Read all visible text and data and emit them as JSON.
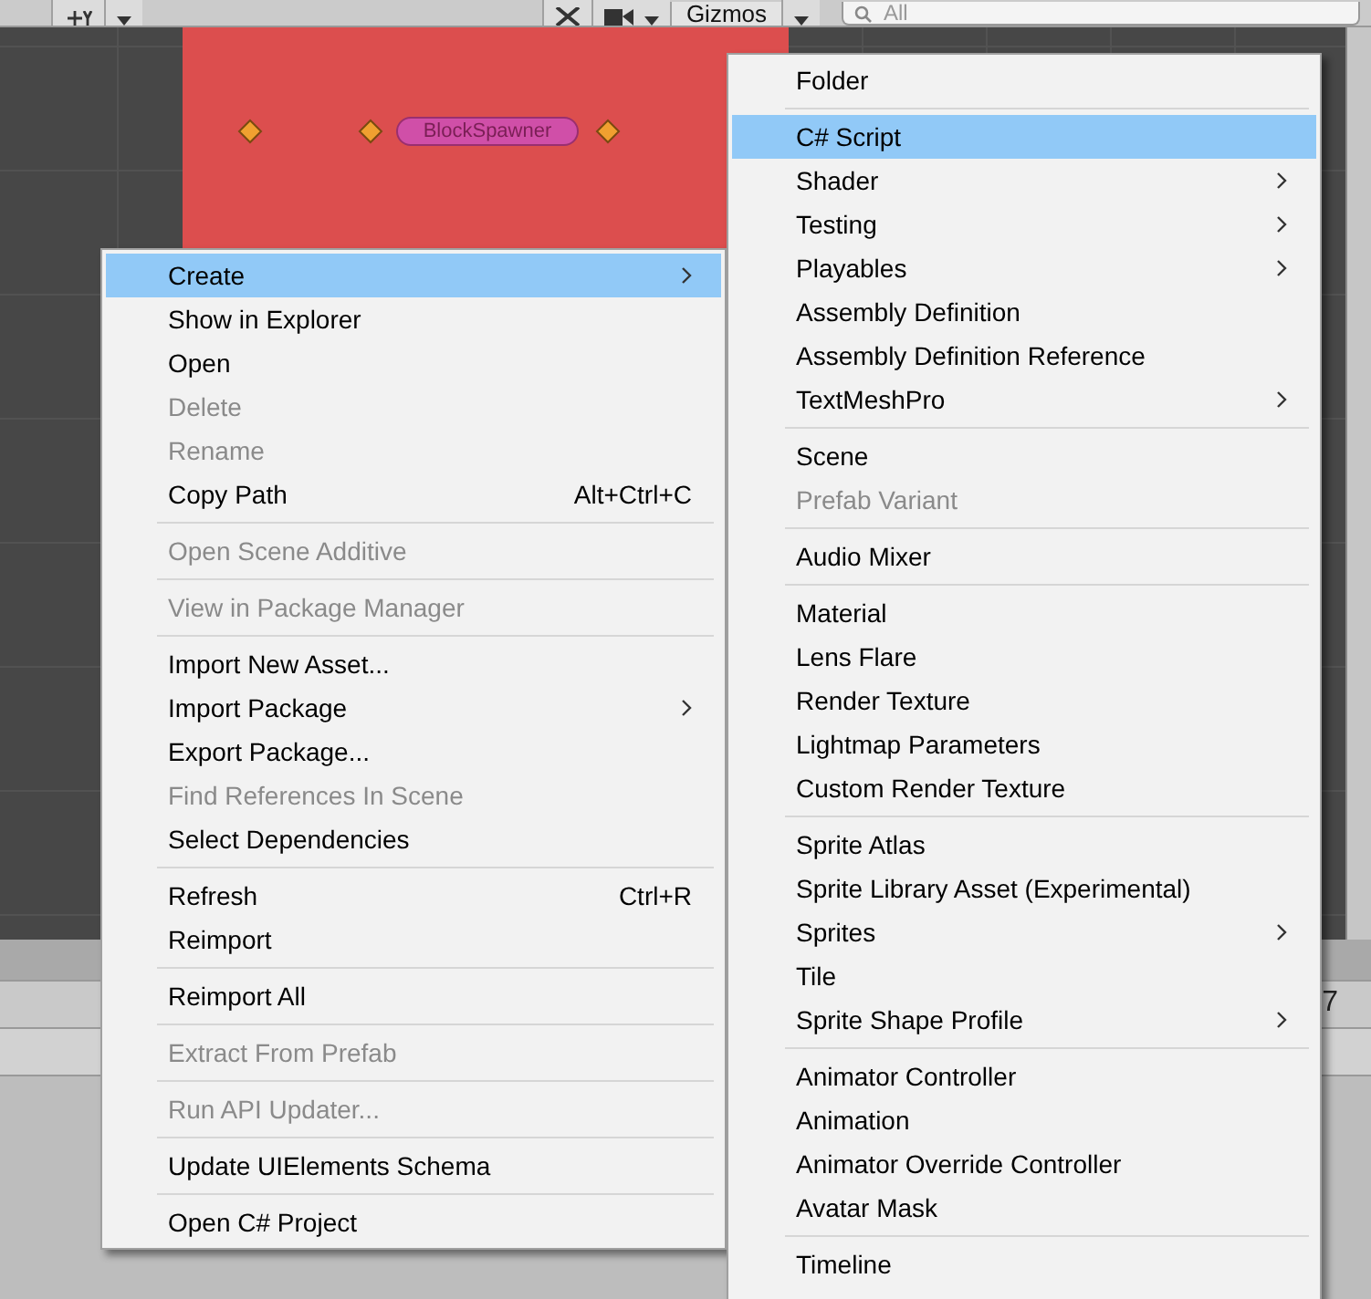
{
  "toolbar": {
    "gizmos_label": "Gizmos",
    "search": {
      "placeholder": "All"
    }
  },
  "scene": {
    "object_label": "BlockSpawner"
  },
  "side_panel": {
    "column_1": "7"
  },
  "context_menu": {
    "items": [
      {
        "kind": "item",
        "label": "Create",
        "submenu": true,
        "selected": true,
        "disabled": false
      },
      {
        "kind": "item",
        "label": "Show in Explorer",
        "submenu": false,
        "selected": false,
        "disabled": false
      },
      {
        "kind": "item",
        "label": "Open",
        "submenu": false,
        "selected": false,
        "disabled": false
      },
      {
        "kind": "item",
        "label": "Delete",
        "submenu": false,
        "selected": false,
        "disabled": true
      },
      {
        "kind": "item",
        "label": "Rename",
        "submenu": false,
        "selected": false,
        "disabled": true
      },
      {
        "kind": "item",
        "label": "Copy Path",
        "shortcut": "Alt+Ctrl+C",
        "submenu": false,
        "selected": false,
        "disabled": false
      },
      {
        "kind": "separator"
      },
      {
        "kind": "item",
        "label": "Open Scene Additive",
        "submenu": false,
        "selected": false,
        "disabled": true
      },
      {
        "kind": "separator"
      },
      {
        "kind": "item",
        "label": "View in Package Manager",
        "submenu": false,
        "selected": false,
        "disabled": true
      },
      {
        "kind": "separator"
      },
      {
        "kind": "item",
        "label": "Import New Asset...",
        "submenu": false,
        "selected": false,
        "disabled": false
      },
      {
        "kind": "item",
        "label": "Import Package",
        "submenu": true,
        "selected": false,
        "disabled": false
      },
      {
        "kind": "item",
        "label": "Export Package...",
        "submenu": false,
        "selected": false,
        "disabled": false
      },
      {
        "kind": "item",
        "label": "Find References In Scene",
        "submenu": false,
        "selected": false,
        "disabled": true
      },
      {
        "kind": "item",
        "label": "Select Dependencies",
        "submenu": false,
        "selected": false,
        "disabled": false
      },
      {
        "kind": "separator"
      },
      {
        "kind": "item",
        "label": "Refresh",
        "shortcut": "Ctrl+R",
        "submenu": false,
        "selected": false,
        "disabled": false
      },
      {
        "kind": "item",
        "label": "Reimport",
        "submenu": false,
        "selected": false,
        "disabled": false
      },
      {
        "kind": "separator"
      },
      {
        "kind": "item",
        "label": "Reimport All",
        "submenu": false,
        "selected": false,
        "disabled": false
      },
      {
        "kind": "separator"
      },
      {
        "kind": "item",
        "label": "Extract From Prefab",
        "submenu": false,
        "selected": false,
        "disabled": true
      },
      {
        "kind": "separator"
      },
      {
        "kind": "item",
        "label": "Run API Updater...",
        "submenu": false,
        "selected": false,
        "disabled": true
      },
      {
        "kind": "separator"
      },
      {
        "kind": "item",
        "label": "Update UIElements Schema",
        "submenu": false,
        "selected": false,
        "disabled": false
      },
      {
        "kind": "separator"
      },
      {
        "kind": "item",
        "label": "Open C# Project",
        "submenu": false,
        "selected": false,
        "disabled": false
      }
    ]
  },
  "create_submenu": {
    "items": [
      {
        "kind": "item",
        "label": "Folder",
        "submenu": false,
        "selected": false,
        "disabled": false
      },
      {
        "kind": "separator"
      },
      {
        "kind": "item",
        "label": "C# Script",
        "submenu": false,
        "selected": true,
        "disabled": false
      },
      {
        "kind": "item",
        "label": "Shader",
        "submenu": true,
        "selected": false,
        "disabled": false
      },
      {
        "kind": "item",
        "label": "Testing",
        "submenu": true,
        "selected": false,
        "disabled": false
      },
      {
        "kind": "item",
        "label": "Playables",
        "submenu": true,
        "selected": false,
        "disabled": false
      },
      {
        "kind": "item",
        "label": "Assembly Definition",
        "submenu": false,
        "selected": false,
        "disabled": false
      },
      {
        "kind": "item",
        "label": "Assembly Definition Reference",
        "submenu": false,
        "selected": false,
        "disabled": false
      },
      {
        "kind": "item",
        "label": "TextMeshPro",
        "submenu": true,
        "selected": false,
        "disabled": false
      },
      {
        "kind": "separator"
      },
      {
        "kind": "item",
        "label": "Scene",
        "submenu": false,
        "selected": false,
        "disabled": false
      },
      {
        "kind": "item",
        "label": "Prefab Variant",
        "submenu": false,
        "selected": false,
        "disabled": true
      },
      {
        "kind": "separator"
      },
      {
        "kind": "item",
        "label": "Audio Mixer",
        "submenu": false,
        "selected": false,
        "disabled": false
      },
      {
        "kind": "separator"
      },
      {
        "kind": "item",
        "label": "Material",
        "submenu": false,
        "selected": false,
        "disabled": false
      },
      {
        "kind": "item",
        "label": "Lens Flare",
        "submenu": false,
        "selected": false,
        "disabled": false
      },
      {
        "kind": "item",
        "label": "Render Texture",
        "submenu": false,
        "selected": false,
        "disabled": false
      },
      {
        "kind": "item",
        "label": "Lightmap Parameters",
        "submenu": false,
        "selected": false,
        "disabled": false
      },
      {
        "kind": "item",
        "label": "Custom Render Texture",
        "submenu": false,
        "selected": false,
        "disabled": false
      },
      {
        "kind": "separator"
      },
      {
        "kind": "item",
        "label": "Sprite Atlas",
        "submenu": false,
        "selected": false,
        "disabled": false
      },
      {
        "kind": "item",
        "label": "Sprite Library Asset (Experimental)",
        "submenu": false,
        "selected": false,
        "disabled": false
      },
      {
        "kind": "item",
        "label": "Sprites",
        "submenu": true,
        "selected": false,
        "disabled": false
      },
      {
        "kind": "item",
        "label": "Tile",
        "submenu": false,
        "selected": false,
        "disabled": false
      },
      {
        "kind": "item",
        "label": "Sprite Shape Profile",
        "submenu": true,
        "selected": false,
        "disabled": false
      },
      {
        "kind": "separator"
      },
      {
        "kind": "item",
        "label": "Animator Controller",
        "submenu": false,
        "selected": false,
        "disabled": false
      },
      {
        "kind": "item",
        "label": "Animation",
        "submenu": false,
        "selected": false,
        "disabled": false
      },
      {
        "kind": "item",
        "label": "Animator Override Controller",
        "submenu": false,
        "selected": false,
        "disabled": false
      },
      {
        "kind": "item",
        "label": "Avatar Mask",
        "submenu": false,
        "selected": false,
        "disabled": false
      },
      {
        "kind": "separator"
      },
      {
        "kind": "item",
        "label": "Timeline",
        "submenu": false,
        "selected": false,
        "disabled": false
      }
    ]
  }
}
